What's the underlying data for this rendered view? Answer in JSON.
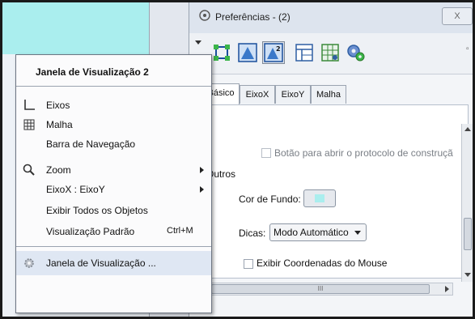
{
  "background": {
    "color": "#aaeeee"
  },
  "preferences": {
    "title": "Preferências - (2)",
    "close_label": "X",
    "toolbar_icons": [
      "graphics-icon",
      "graphics-2-icon",
      "algebra-icon",
      "grid-icon",
      "settings-icon"
    ],
    "tabs": [
      {
        "label": "Básico",
        "active": true
      },
      {
        "label": "EixoX",
        "active": false
      },
      {
        "label": "EixoY",
        "active": false
      },
      {
        "label": "Malha",
        "active": false
      }
    ],
    "nav_checkbox_label": "Botão para abrir o protocolo de construçã",
    "section_title": "Outros",
    "background_color_label": "Cor de Fundo:",
    "background_color_value": "#aaeeee",
    "tooltips_label": "Dicas:",
    "tooltips_value": "Modo Automático",
    "mouse_coords_label": "Exibir Coordenadas do Mouse",
    "hscroll_mark": "III"
  },
  "menu": {
    "title": "Janela de Visualização 2",
    "items": [
      {
        "label": "Eixos",
        "icon": "axes-icon",
        "submenu": false,
        "shortcut": ""
      },
      {
        "label": "Malha",
        "icon": "grid-icon",
        "submenu": false,
        "shortcut": ""
      },
      {
        "label": "Barra de Navegação",
        "icon": "",
        "submenu": false,
        "shortcut": ""
      },
      {
        "label": "Zoom",
        "icon": "magnifier-icon",
        "submenu": true,
        "shortcut": ""
      },
      {
        "label": "EixoX : EixoY",
        "icon": "",
        "submenu": true,
        "shortcut": ""
      },
      {
        "label": "Exibir Todos os Objetos",
        "icon": "",
        "submenu": false,
        "shortcut": ""
      },
      {
        "label": "Visualização Padrão",
        "icon": "",
        "submenu": false,
        "shortcut": "Ctrl+M"
      },
      {
        "label": "Janela de Visualização ...",
        "icon": "gear-icon",
        "submenu": false,
        "shortcut": ""
      }
    ]
  }
}
